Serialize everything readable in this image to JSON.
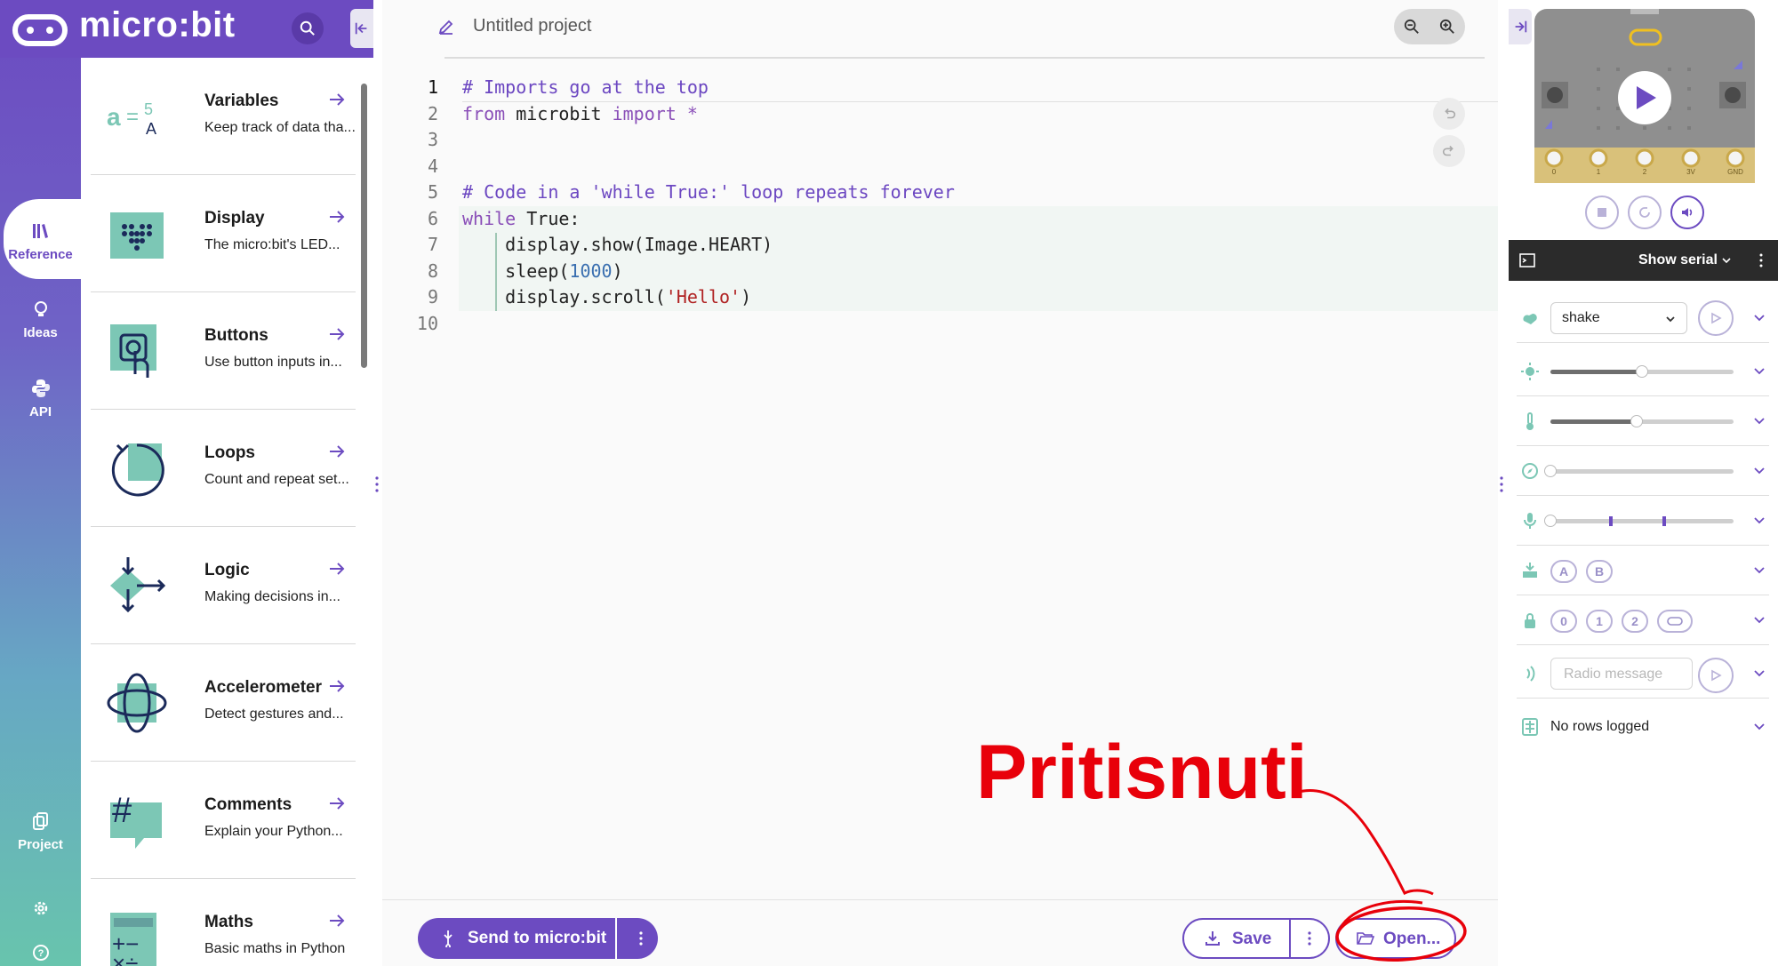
{
  "brand": {
    "name": "micro:bit"
  },
  "nav": {
    "items": [
      {
        "label": "Reference",
        "icon": "books-icon"
      },
      {
        "label": "Ideas",
        "icon": "lightbulb-icon"
      },
      {
        "label": "API",
        "icon": "python-icon"
      },
      {
        "label": "Project",
        "icon": "files-icon"
      }
    ]
  },
  "reference": {
    "items": [
      {
        "title": "Variables",
        "desc": "Keep track of data tha..."
      },
      {
        "title": "Display",
        "desc": "The micro:bit's LED..."
      },
      {
        "title": "Buttons",
        "desc": "Use button inputs in..."
      },
      {
        "title": "Loops",
        "desc": "Count and repeat set..."
      },
      {
        "title": "Logic",
        "desc": "Making decisions in..."
      },
      {
        "title": "Accelerometer",
        "desc": "Detect gestures and..."
      },
      {
        "title": "Comments",
        "desc": "Explain your Python..."
      },
      {
        "title": "Maths",
        "desc": "Basic maths in Python"
      }
    ]
  },
  "editor": {
    "project_name": "Untitled project",
    "line_numbers": [
      "1",
      "2",
      "3",
      "4",
      "5",
      "6",
      "7",
      "8",
      "9",
      "10"
    ],
    "code": {
      "l1": "# Imports go at the top",
      "l2_kw1": "from",
      "l2_mod": " microbit ",
      "l2_kw2": "import",
      "l2_star": " *",
      "l5": "# Code in a 'while True:' loop repeats forever",
      "l6_kw": "while",
      "l6_rest": " True:",
      "l7": "    display.show(Image.HEART)",
      "l8_a": "    sleep(",
      "l8_num": "1000",
      "l8_b": ")",
      "l9_a": "    display.scroll(",
      "l9_str": "'Hello'",
      "l9_b": ")"
    }
  },
  "toolbar": {
    "send_label": "Send to micro:bit",
    "save_label": "Save",
    "open_label": "Open..."
  },
  "annotation": {
    "text": "Pritisnuti",
    "color": "#e8000a"
  },
  "simulator": {
    "serial_label": "Show serial",
    "gesture_value": "shake",
    "light_level": 0.5,
    "temperature_level": 0.47,
    "compass_level": 0.0,
    "sound_level": 0.0,
    "buttons": [
      "A",
      "B"
    ],
    "pins": [
      "0",
      "1",
      "2"
    ],
    "radio_placeholder": "Radio message",
    "log_label": "No rows logged",
    "pin_labels": [
      "0",
      "1",
      "2",
      "3V",
      "GND"
    ]
  },
  "colors": {
    "brand": "#6c4bc1",
    "rail_end": "#68c4ad",
    "annotation": "#e8000a"
  }
}
